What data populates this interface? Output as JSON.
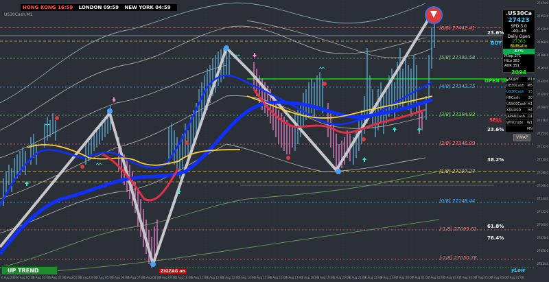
{
  "window": {
    "symbol_code": "US30Cash,M1"
  },
  "session": {
    "hongkong": "HONG KONG 16:59",
    "london": "LONDON 09:59",
    "newyork": "NEW YORK 04:59"
  },
  "trend_label": "UP TREND",
  "zigzag_label": "ZIGZAG on",
  "panel": {
    "symbol": ".US30Ca",
    "price": "27423",
    "spd": "SPD:3.0",
    "change": "-40:-46",
    "daily_open_label": "Daily Open",
    "daily_open": "27363",
    "bid_ratio_label": "BidRatio",
    "bid_ratio": "87%",
    "rows": [
      {
        "label": "PDop",
        "value": "271"
      },
      {
        "label": "HiLo",
        "value": "383"
      },
      {
        "label": "ADR",
        "value": "351"
      }
    ],
    "last": "2094"
  },
  "watchlist": [
    {
      "symbol": "USDJPY",
      "tf": "M1",
      "active": false
    },
    {
      "symbol": "DE30Cash",
      "tf": "M5",
      "active": false
    },
    {
      "symbol": "US30Cash",
      "tf": "15",
      "active": true
    },
    {
      "symbol": "HKCash",
      "tf": "30",
      "active": false
    },
    {
      "symbol": "US500Cash",
      "tf": "H1",
      "active": false
    },
    {
      "symbol": "XAUUSD",
      "tf": "H4",
      "active": false
    },
    {
      "symbol": "JAPANCash",
      "tf": "D1",
      "active": false
    },
    {
      "symbol": "WTICrude",
      "tf": "W1",
      "active": false
    },
    {
      "symbol": "",
      "tf": "MN",
      "active": false
    }
  ],
  "vwap_label": "VWAP",
  "levels": [
    {
      "label": "[8/8]  27441.41",
      "color": "#ff7070"
    },
    {
      "label": "[5/8]  27392.58",
      "color": "#7bd06a"
    },
    {
      "label": "[4/8]  27343.75",
      "color": "#4fb0ff"
    },
    {
      "label": "[3/8]  27294.92",
      "color": "#7bd06a"
    },
    {
      "label": "[2/8]  27246.09",
      "color": "#ff7070"
    },
    {
      "label": "[1/8]  27197.27",
      "color": "#ffd23a"
    },
    {
      "label": "[0/8]  27148.44",
      "color": "#4fb0ff"
    },
    {
      "label": "[-1/8]  27099.61",
      "color": "#ff7070"
    },
    {
      "label": "[-2/8]  27050.78",
      "color": "#ff7070"
    }
  ],
  "fibs": [
    "23.6%",
    "23.6%",
    "38.2%",
    "61.8%",
    "76.4%"
  ],
  "signals": {
    "buy": "BUY",
    "sell": "SELL",
    "open_up": "OPEN UP",
    "ylow": "yLow"
  },
  "colors": {
    "background": "#2b3038",
    "buy": "#3fc7ff",
    "sell": "#ff5050",
    "open_up": "#00ff00"
  },
  "price_axis": [
    "27474.0",
    "27452.0",
    "27430.0",
    "27408.0",
    "27386.0",
    "27364.0",
    "27342.0",
    "27320.0",
    "27298.0",
    "27276.0",
    "27254.0",
    "27232.0",
    "27210.0",
    "27188.0",
    "27166.0",
    "27144.0",
    "27122.0",
    "27100.0",
    "27078.0",
    "27056.0",
    "27034.0"
  ],
  "time_axis": [
    "6 Aug 2020",
    "6 Aug 00:20",
    "6 Aug 01:00",
    "6 Aug 02:00",
    "6 Aug 03:00",
    "6 Aug 04:00",
    "6 Aug 05:00",
    "6 Aug 06:00",
    "6 Aug 07:00",
    "6 Aug 08:00",
    "6 Aug 09:00",
    "6 Aug 10:00",
    "6 Aug 11:00",
    "6 Aug 12:00",
    "6 Aug 13:00",
    "6 Aug 14:00",
    "6 Aug 15:00",
    "6 Aug 16:00",
    "6 Aug 17:00",
    "6 Aug 18:00",
    "6 Aug 19:00",
    "6 Aug 20:00",
    "6 Aug 21:00",
    "6 Aug 22:00",
    "6 Aug 23:00",
    "7 Aug 00:00",
    "7 Aug 01:00",
    "7 Aug 02:00",
    "7 Aug 03:00",
    "7 Aug 04:00",
    "7 Aug 05:00",
    "7 Aug 06:00",
    "7 Aug 07:00"
  ]
}
